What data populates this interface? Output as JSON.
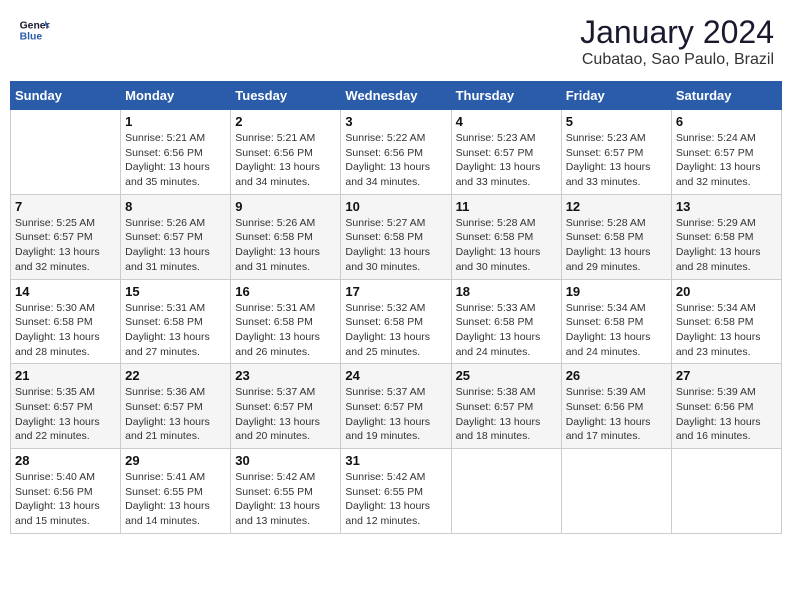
{
  "header": {
    "logo_line1": "General",
    "logo_line2": "Blue",
    "title": "January 2024",
    "subtitle": "Cubatao, Sao Paulo, Brazil"
  },
  "columns": [
    "Sunday",
    "Monday",
    "Tuesday",
    "Wednesday",
    "Thursday",
    "Friday",
    "Saturday"
  ],
  "weeks": [
    [
      {
        "date": "",
        "info": ""
      },
      {
        "date": "1",
        "info": "Sunrise: 5:21 AM\nSunset: 6:56 PM\nDaylight: 13 hours\nand 35 minutes."
      },
      {
        "date": "2",
        "info": "Sunrise: 5:21 AM\nSunset: 6:56 PM\nDaylight: 13 hours\nand 34 minutes."
      },
      {
        "date": "3",
        "info": "Sunrise: 5:22 AM\nSunset: 6:56 PM\nDaylight: 13 hours\nand 34 minutes."
      },
      {
        "date": "4",
        "info": "Sunrise: 5:23 AM\nSunset: 6:57 PM\nDaylight: 13 hours\nand 33 minutes."
      },
      {
        "date": "5",
        "info": "Sunrise: 5:23 AM\nSunset: 6:57 PM\nDaylight: 13 hours\nand 33 minutes."
      },
      {
        "date": "6",
        "info": "Sunrise: 5:24 AM\nSunset: 6:57 PM\nDaylight: 13 hours\nand 32 minutes."
      }
    ],
    [
      {
        "date": "7",
        "info": "Sunrise: 5:25 AM\nSunset: 6:57 PM\nDaylight: 13 hours\nand 32 minutes."
      },
      {
        "date": "8",
        "info": "Sunrise: 5:26 AM\nSunset: 6:57 PM\nDaylight: 13 hours\nand 31 minutes."
      },
      {
        "date": "9",
        "info": "Sunrise: 5:26 AM\nSunset: 6:58 PM\nDaylight: 13 hours\nand 31 minutes."
      },
      {
        "date": "10",
        "info": "Sunrise: 5:27 AM\nSunset: 6:58 PM\nDaylight: 13 hours\nand 30 minutes."
      },
      {
        "date": "11",
        "info": "Sunrise: 5:28 AM\nSunset: 6:58 PM\nDaylight: 13 hours\nand 30 minutes."
      },
      {
        "date": "12",
        "info": "Sunrise: 5:28 AM\nSunset: 6:58 PM\nDaylight: 13 hours\nand 29 minutes."
      },
      {
        "date": "13",
        "info": "Sunrise: 5:29 AM\nSunset: 6:58 PM\nDaylight: 13 hours\nand 28 minutes."
      }
    ],
    [
      {
        "date": "14",
        "info": "Sunrise: 5:30 AM\nSunset: 6:58 PM\nDaylight: 13 hours\nand 28 minutes."
      },
      {
        "date": "15",
        "info": "Sunrise: 5:31 AM\nSunset: 6:58 PM\nDaylight: 13 hours\nand 27 minutes."
      },
      {
        "date": "16",
        "info": "Sunrise: 5:31 AM\nSunset: 6:58 PM\nDaylight: 13 hours\nand 26 minutes."
      },
      {
        "date": "17",
        "info": "Sunrise: 5:32 AM\nSunset: 6:58 PM\nDaylight: 13 hours\nand 25 minutes."
      },
      {
        "date": "18",
        "info": "Sunrise: 5:33 AM\nSunset: 6:58 PM\nDaylight: 13 hours\nand 24 minutes."
      },
      {
        "date": "19",
        "info": "Sunrise: 5:34 AM\nSunset: 6:58 PM\nDaylight: 13 hours\nand 24 minutes."
      },
      {
        "date": "20",
        "info": "Sunrise: 5:34 AM\nSunset: 6:58 PM\nDaylight: 13 hours\nand 23 minutes."
      }
    ],
    [
      {
        "date": "21",
        "info": "Sunrise: 5:35 AM\nSunset: 6:57 PM\nDaylight: 13 hours\nand 22 minutes."
      },
      {
        "date": "22",
        "info": "Sunrise: 5:36 AM\nSunset: 6:57 PM\nDaylight: 13 hours\nand 21 minutes."
      },
      {
        "date": "23",
        "info": "Sunrise: 5:37 AM\nSunset: 6:57 PM\nDaylight: 13 hours\nand 20 minutes."
      },
      {
        "date": "24",
        "info": "Sunrise: 5:37 AM\nSunset: 6:57 PM\nDaylight: 13 hours\nand 19 minutes."
      },
      {
        "date": "25",
        "info": "Sunrise: 5:38 AM\nSunset: 6:57 PM\nDaylight: 13 hours\nand 18 minutes."
      },
      {
        "date": "26",
        "info": "Sunrise: 5:39 AM\nSunset: 6:56 PM\nDaylight: 13 hours\nand 17 minutes."
      },
      {
        "date": "27",
        "info": "Sunrise: 5:39 AM\nSunset: 6:56 PM\nDaylight: 13 hours\nand 16 minutes."
      }
    ],
    [
      {
        "date": "28",
        "info": "Sunrise: 5:40 AM\nSunset: 6:56 PM\nDaylight: 13 hours\nand 15 minutes."
      },
      {
        "date": "29",
        "info": "Sunrise: 5:41 AM\nSunset: 6:55 PM\nDaylight: 13 hours\nand 14 minutes."
      },
      {
        "date": "30",
        "info": "Sunrise: 5:42 AM\nSunset: 6:55 PM\nDaylight: 13 hours\nand 13 minutes."
      },
      {
        "date": "31",
        "info": "Sunrise: 5:42 AM\nSunset: 6:55 PM\nDaylight: 13 hours\nand 12 minutes."
      },
      {
        "date": "",
        "info": ""
      },
      {
        "date": "",
        "info": ""
      },
      {
        "date": "",
        "info": ""
      }
    ]
  ]
}
